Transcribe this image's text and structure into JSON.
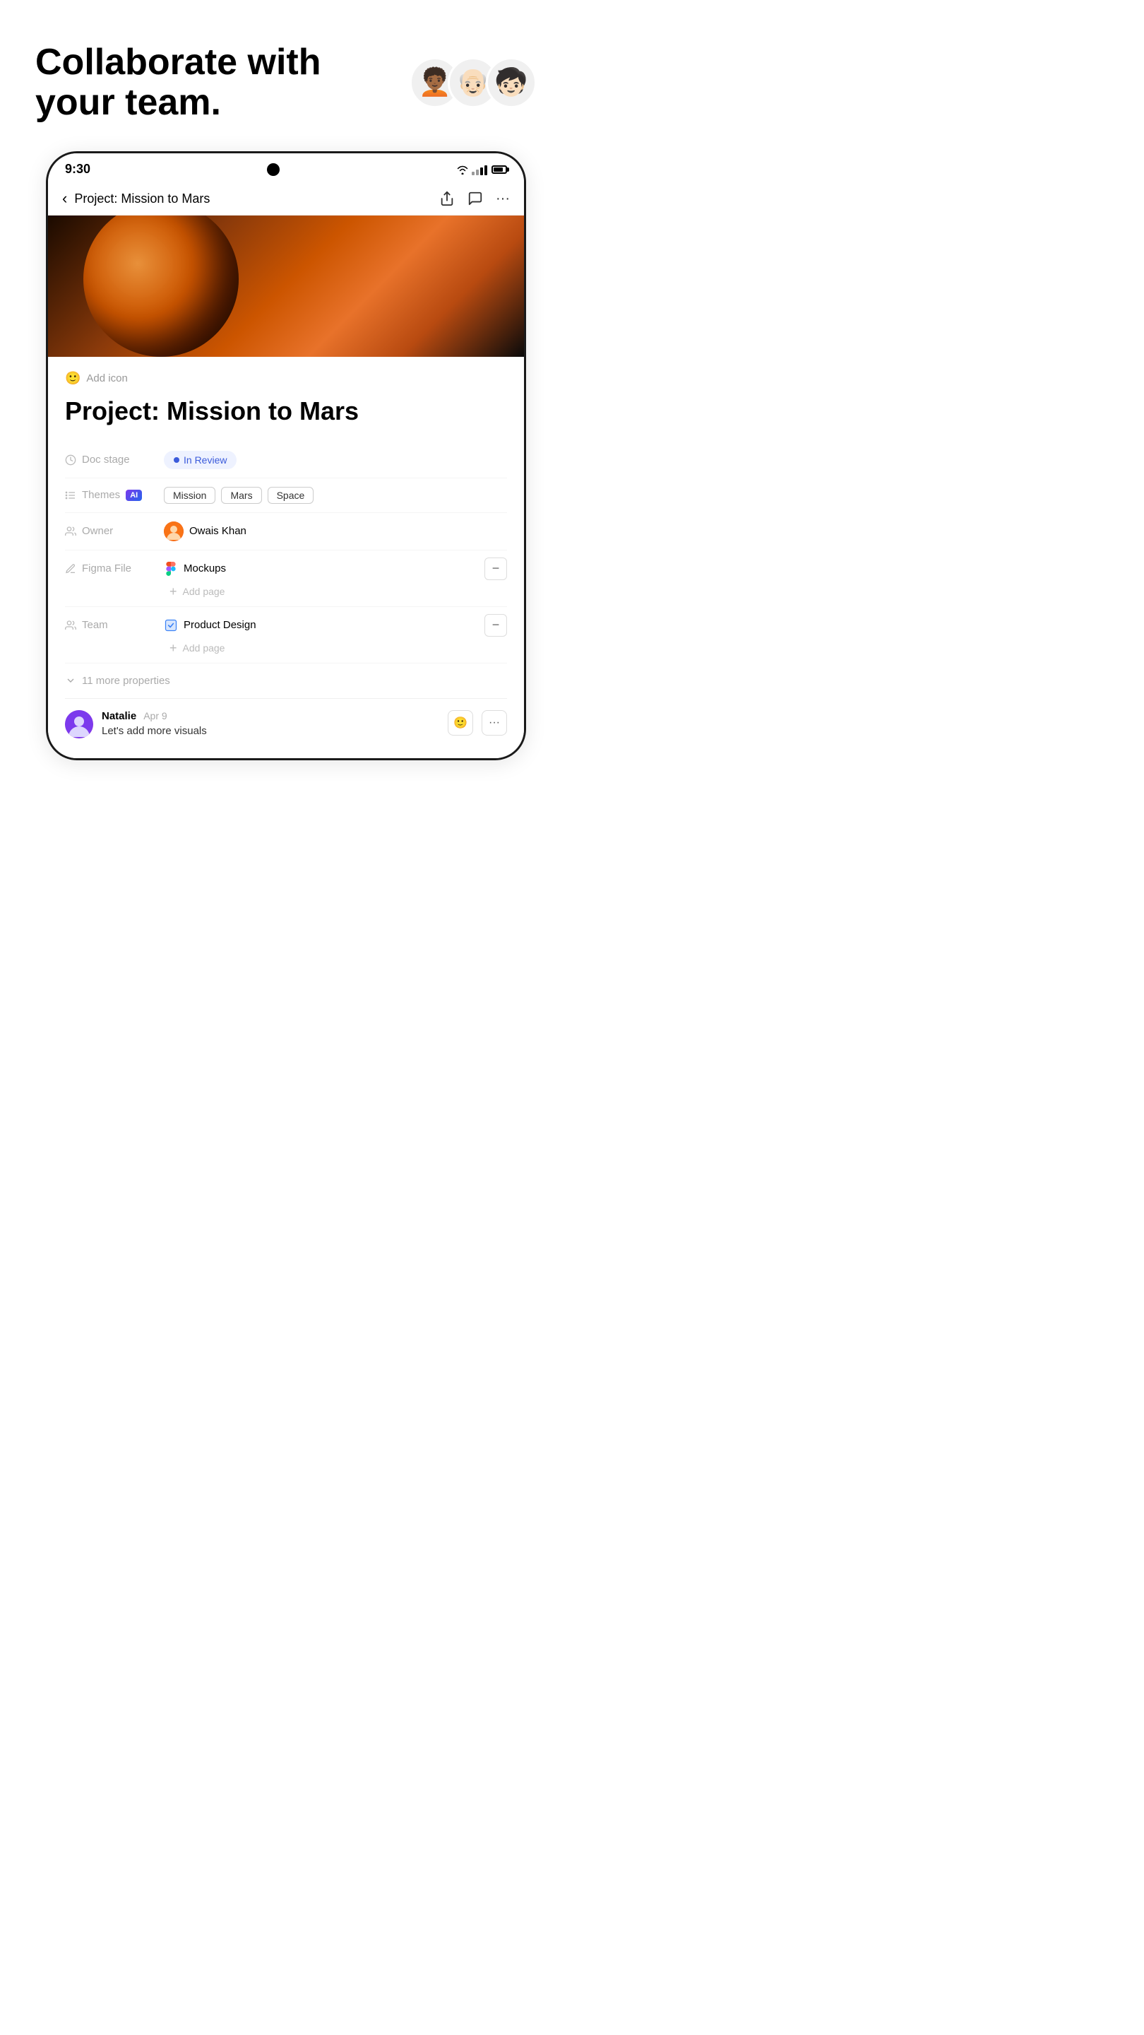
{
  "hero": {
    "title_line1": "Collaborate with",
    "title_line2": "your team.",
    "avatars": [
      "🧑🏾‍🦱",
      "👴🏻",
      "🧑🏻‍🦱"
    ]
  },
  "statusBar": {
    "time": "9:30"
  },
  "navbar": {
    "back_label": "‹",
    "title": "Project: Mission to Mars",
    "share_label": "⬆",
    "chat_label": "💬",
    "more_label": "···"
  },
  "document": {
    "add_icon_label": "Add icon",
    "title": "Project: Mission to Mars",
    "properties": {
      "doc_stage": {
        "label": "Doc stage",
        "status": "In Review"
      },
      "themes": {
        "label": "Themes",
        "tags": [
          "Mission",
          "Mars",
          "Space"
        ]
      },
      "owner": {
        "label": "Owner",
        "name": "Owais Khan"
      },
      "figma_file": {
        "label": "Figma File",
        "file_name": "Mockups",
        "add_page_label": "Add page"
      },
      "team": {
        "label": "Team",
        "file_name": "Product Design",
        "add_page_label": "Add page"
      }
    },
    "more_properties": "11 more properties"
  },
  "comment": {
    "author": "Natalie",
    "date": "Apr 9",
    "text": "Let's add more visuals"
  }
}
